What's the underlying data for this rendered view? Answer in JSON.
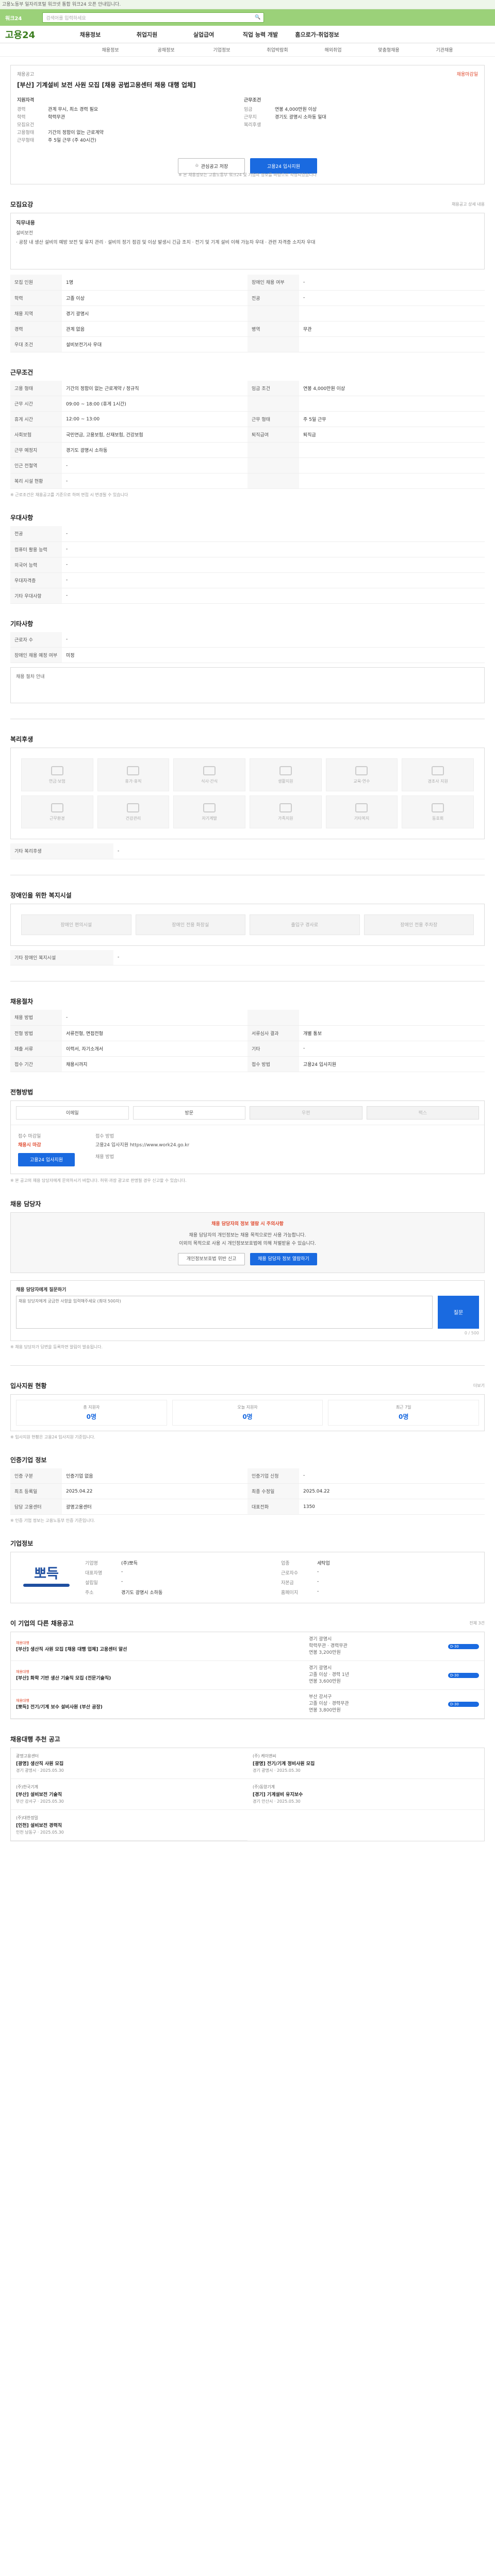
{
  "topbar": {
    "notice": "고용노동부 일자리포털 워크넷 통합 워크24 오픈 안내입니다."
  },
  "search": {
    "logo": "워크24",
    "placeholder": "검색어를 입력하세요",
    "btn": "검색"
  },
  "header": {
    "logo": "고용24",
    "menu": [
      "채용정보",
      "취업지원",
      "실업급여",
      "직업 능력 개발",
      "홈으로가·취업정보"
    ]
  },
  "subnav": [
    "채용정보",
    "공채정보",
    "기업정보",
    "취업박람회",
    "해외취업",
    "맞춤형채용",
    "기관채용"
  ],
  "job": {
    "badge": "채용공고",
    "dday": "채용마감일",
    "title": "[부산] 기계설비 보전 사원 모집 [채용 공법고용센터 채용 대행 업체]",
    "left_head": "지원자격",
    "left": [
      {
        "k": "경력",
        "v": "관계 무시, 최소 경력 필요"
      },
      {
        "k": "학력",
        "v": "학력무관"
      },
      {
        "k": "",
        "v": ""
      },
      {
        "k": "모집요건",
        "v": ""
      },
      {
        "k": "고용형태",
        "v": "기간의 정함이 없는 근로계약"
      },
      {
        "k": "근무형태",
        "v": "주 5일 근무 (주 40시간)"
      }
    ],
    "right_head": "근무조건",
    "right": [
      {
        "k": "임금",
        "v": "연봉 4,000만원 이상"
      },
      {
        "k": "근무지",
        "v": "경기도 광명시 소하동 일대"
      },
      {
        "k": "",
        "v": ""
      },
      {
        "k": "복리후생",
        "v": ""
      }
    ],
    "btn_scrap": "관심공고 저장",
    "btn_apply": "고용24 입사지원",
    "note": "※ 본 채용정보는 고용노동부 워크24 및 기업의 정보를 바탕으로 작성되었습니다"
  },
  "sec1": {
    "title": "모집요강",
    "small": "채용공고 상세 내용"
  },
  "desc": {
    "head": "직무내용",
    "sub": "설비보전",
    "text": "· 공장 내 생산 설비의 예방 보전 및 유지 관리 · 설비의 정기 점검 및 이상 발생시 긴급 조치 · 전기 및 기계 설비 이해 가능자 우대 · 관련 자격증 소지자 우대"
  },
  "grid1": [
    [
      {
        "k": "모집 인원",
        "v": "1명"
      },
      {
        "k": "장애인 채용 여부",
        "v": "-"
      }
    ],
    [
      {
        "k": "학력",
        "v": "고졸 이상"
      },
      {
        "k": "전공",
        "v": "-"
      }
    ],
    [
      {
        "k": "채용 지역",
        "v": "경기 광명시"
      },
      {
        "k": "",
        "v": ""
      }
    ],
    [
      {
        "k": "경력",
        "v": "관계 없음"
      },
      {
        "k": "병역",
        "v": "무관"
      }
    ],
    [
      {
        "k": "우대 조건",
        "v": "설비보전기사 우대"
      },
      {
        "k": "",
        "v": ""
      }
    ]
  ],
  "sec2": {
    "title": "근무조건"
  },
  "grid2": [
    [
      {
        "k": "고용 형태",
        "v": "기간의 정함이 없는 근로계약 / 정규직"
      },
      {
        "k": "임금 조건",
        "v": "연봉 4,000만원 이상"
      }
    ],
    [
      {
        "k": "근무 시간",
        "v": "09:00 ~ 18:00 (휴게 1시간)"
      },
      {
        "k": "",
        "v": ""
      }
    ],
    [
      {
        "k": "휴게 시간",
        "v": "12:00 ~ 13:00"
      },
      {
        "k": "근무 형태",
        "v": "주 5일 근무"
      }
    ],
    [
      {
        "k": "사회보험",
        "v": "국민연금, 고용보험, 산재보험, 건강보험"
      },
      {
        "k": "퇴직급여",
        "v": "퇴직금"
      }
    ],
    [
      {
        "k": "근무 예정지",
        "v": "경기도 광명시 소하동"
      },
      {
        "k": "",
        "v": ""
      }
    ],
    [
      {
        "k": "인근 전철역",
        "v": "-"
      },
      {
        "k": "",
        "v": ""
      }
    ],
    [
      {
        "k": "복리 시설 현황",
        "v": "-"
      },
      {
        "k": "",
        "v": ""
      }
    ]
  ],
  "grid2_note": "※ 근로조건은 채용공고를 기준으로 하며 면접 시 변경될 수 있습니다",
  "sec3": {
    "title": "우대사항"
  },
  "grid3": [
    {
      "k": "전공",
      "v": "-"
    },
    {
      "k": "컴퓨터 활용 능력",
      "v": "-"
    },
    {
      "k": "외국어 능력",
      "v": "-"
    },
    {
      "k": "우대자격증",
      "v": "-"
    },
    {
      "k": "기타 우대사항",
      "v": "-"
    }
  ],
  "sec4": {
    "title": "기타사항"
  },
  "grid4": [
    {
      "k": "근로자 수",
      "v": "-"
    },
    {
      "k": "장애인 채용 예정 여부",
      "v": "미정"
    }
  ],
  "sec4_note": "채용 절차 안내",
  "sec5": {
    "title": "복리후생"
  },
  "benefits": [
    "연금·보험",
    "휴가·휴직",
    "식사·간식",
    "생활지원",
    "교육·연수",
    "경조사 지원",
    "근무환경",
    "건강관리",
    "자기계발",
    "가족지원",
    "기타복지",
    "동호회"
  ],
  "benefit_etc": {
    "k": "기타 복리후생",
    "v": "-"
  },
  "sec6": {
    "title": "장애인을 위한 복지시설"
  },
  "access": [
    "장애인 편의시설",
    "장애인 전용 화장실",
    "출입구 경사로",
    "장애인 전용 주차장"
  ],
  "access_etc": {
    "k": "기타 장애인 복지시설",
    "v": "-"
  },
  "sec7": {
    "title": "채용절차"
  },
  "grid7": [
    [
      {
        "k": "채용 방법",
        "v": "-"
      },
      {
        "k": "",
        "v": ""
      }
    ],
    [
      {
        "k": "전형 방법",
        "v": "서류전형, 면접전형"
      },
      {
        "k": "서류심사 결과",
        "v": "개별 통보"
      }
    ],
    [
      {
        "k": "제출 서류",
        "v": "이력서, 자기소개서"
      },
      {
        "k": "기타",
        "v": "-"
      }
    ],
    [
      {
        "k": "접수 기간",
        "v": "채용시까지"
      },
      {
        "k": "접수 방법",
        "v": "고용24 입사지원"
      }
    ]
  ],
  "sec8": {
    "title": "전형방법"
  },
  "methods": [
    "이메일",
    "방문",
    "우편",
    "팩스"
  ],
  "method_info": {
    "head": "접수 마감일",
    "date": "채용시 마감",
    "head2": "접수 방법",
    "url": "고용24 입사지원 https://www.work24.go.kr",
    "btn": "고용24 입사지원",
    "label": "채용 방법"
  },
  "method_notes": "※ 본 공고의 채용 담당자에게 문의하시기 바랍니다. 허위·과장 광고로 판명될 경우 신고할 수 있습니다.",
  "sec9": {
    "title": "채용 담당자"
  },
  "contact": {
    "title": "채용 담당자의 정보 열람 시 주의사항",
    "lines": [
      "채용 담당자의 개인정보는 채용 목적으로만 사용 가능합니다.",
      "이외의 목적으로 사용 시 개인정보보호법에 의해 처벌받을 수 있습니다."
    ],
    "btn1": "개인정보보호법 위반 신고",
    "btn2": "채용 담당자 정보 열람하기"
  },
  "qa": {
    "head": "채용 담당자에게 질문하기",
    "ph": "채용 담당자에게 궁금한 사항을 입력해주세요 (최대 500자)",
    "btn": "질문",
    "count": "0 / 500"
  },
  "qa_note": "※ 채용 담당자가 답변을 등록하면 알림이 발송됩니다.",
  "sec10": {
    "title": "입사지원 현황",
    "small": "더보기"
  },
  "applicants": [
    {
      "k": "총 지원자",
      "v": "0명"
    },
    {
      "k": "오늘 지원자",
      "v": "0명"
    },
    {
      "k": "최근 7일",
      "v": "0명"
    }
  ],
  "applicant_note": "※ 입사지원 현황은 고용24 입사지원 기준입니다.",
  "sec11": {
    "title": "인증기업 정보"
  },
  "grid11": [
    [
      {
        "k": "인증 구분",
        "v": "인증기업 없음"
      },
      {
        "k": "인증기업 신청",
        "v": "-"
      }
    ],
    [
      {
        "k": "최초 등록일",
        "v": "2025.04.22"
      },
      {
        "k": "최종 수정일",
        "v": "2025.04.22"
      }
    ],
    [
      {
        "k": "담당 고용센터",
        "v": "광명고용센터"
      },
      {
        "k": "대표전화",
        "v": "1350"
      }
    ]
  ],
  "grid11_note": "※ 인증 기업 정보는 고용노동부 인증 기준입니다.",
  "sec12": {
    "title": "기업정보"
  },
  "company": {
    "logo": "뽀득",
    "rows": [
      {
        "k": "기업명",
        "v": "(주)뽀득"
      },
      {
        "k": "업종",
        "v": "세탁업"
      },
      {
        "k": "대표자명",
        "v": "-"
      },
      {
        "k": "근로자수",
        "v": "-"
      },
      {
        "k": "설립일",
        "v": "-"
      },
      {
        "k": "자본금",
        "v": "-"
      },
      {
        "k": "주소",
        "v": "경기도 광명시 소하동"
      },
      {
        "k": "홈페이지",
        "v": "-"
      }
    ]
  },
  "sec13": {
    "title": "이 기업의 다른 채용공고",
    "small": "전체 3건"
  },
  "related": [
    {
      "badge": "채용대행",
      "title": "[부산] 생산직 사원 모집 [채용 대행 업체] 고용센터 알선",
      "meta1": "경기 광명시",
      "meta2": "학력무관 · 경력무관",
      "meta3": "연봉 3,200만원",
      "d": "D-30"
    },
    {
      "badge": "채용대행",
      "title": "[부산] 화학 기반 생산 기술직 모집 (전문기술직)",
      "meta1": "경기 광명시",
      "meta2": "고졸 이상 · 경력 1년",
      "meta3": "연봉 3,600만원",
      "d": "D-30"
    },
    {
      "badge": "채용대행",
      "title": "[뽀득] 전기/기계 보수 설비사원 (부산 공장)",
      "meta1": "부산 강서구",
      "meta2": "고졸 이상 · 경력무관",
      "meta3": "연봉 3,800만원",
      "d": "D-30"
    }
  ],
  "sec14": {
    "title": "채용대행 추천 공고"
  },
  "recommend": [
    {
      "c": "광명고용센터",
      "t": "[광명] 생산직 사원 모집",
      "m": "경기 광명시 · 2025.05.30"
    },
    {
      "c": "(주) 케이앤씨",
      "t": "[광명] 전기/기계 정비사원 모집",
      "m": "경기 광명시 · 2025.05.30"
    },
    {
      "c": "(주)한국기계",
      "t": "[부산] 설비보전 기술직",
      "m": "부산 강서구 · 2025.05.30"
    },
    {
      "c": "(주)동양기계",
      "t": "[경기] 기계설비 유지보수",
      "m": "경기 안산시 · 2025.05.30"
    },
    {
      "c": "(주)대한정밀",
      "t": "[인천] 설비보전 경력직",
      "m": "인천 남동구 · 2025.05.30"
    }
  ]
}
